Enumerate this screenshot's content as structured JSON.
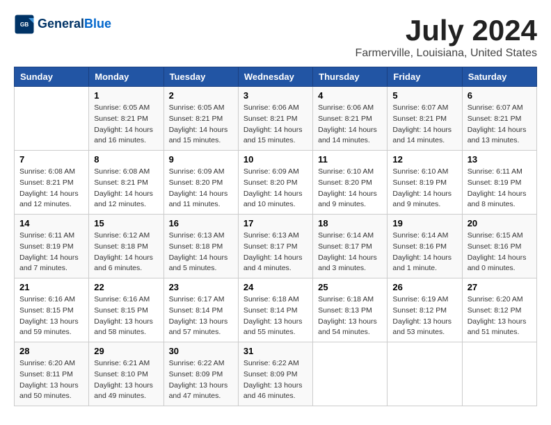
{
  "logo": {
    "line1": "General",
    "line2": "Blue"
  },
  "title": "July 2024",
  "subtitle": "Farmerville, Louisiana, United States",
  "weekdays": [
    "Sunday",
    "Monday",
    "Tuesday",
    "Wednesday",
    "Thursday",
    "Friday",
    "Saturday"
  ],
  "weeks": [
    [
      {
        "day": "",
        "info": ""
      },
      {
        "day": "1",
        "info": "Sunrise: 6:05 AM\nSunset: 8:21 PM\nDaylight: 14 hours\nand 16 minutes."
      },
      {
        "day": "2",
        "info": "Sunrise: 6:05 AM\nSunset: 8:21 PM\nDaylight: 14 hours\nand 15 minutes."
      },
      {
        "day": "3",
        "info": "Sunrise: 6:06 AM\nSunset: 8:21 PM\nDaylight: 14 hours\nand 15 minutes."
      },
      {
        "day": "4",
        "info": "Sunrise: 6:06 AM\nSunset: 8:21 PM\nDaylight: 14 hours\nand 14 minutes."
      },
      {
        "day": "5",
        "info": "Sunrise: 6:07 AM\nSunset: 8:21 PM\nDaylight: 14 hours\nand 14 minutes."
      },
      {
        "day": "6",
        "info": "Sunrise: 6:07 AM\nSunset: 8:21 PM\nDaylight: 14 hours\nand 13 minutes."
      }
    ],
    [
      {
        "day": "7",
        "info": "Sunrise: 6:08 AM\nSunset: 8:21 PM\nDaylight: 14 hours\nand 12 minutes."
      },
      {
        "day": "8",
        "info": "Sunrise: 6:08 AM\nSunset: 8:21 PM\nDaylight: 14 hours\nand 12 minutes."
      },
      {
        "day": "9",
        "info": "Sunrise: 6:09 AM\nSunset: 8:20 PM\nDaylight: 14 hours\nand 11 minutes."
      },
      {
        "day": "10",
        "info": "Sunrise: 6:09 AM\nSunset: 8:20 PM\nDaylight: 14 hours\nand 10 minutes."
      },
      {
        "day": "11",
        "info": "Sunrise: 6:10 AM\nSunset: 8:20 PM\nDaylight: 14 hours\nand 9 minutes."
      },
      {
        "day": "12",
        "info": "Sunrise: 6:10 AM\nSunset: 8:19 PM\nDaylight: 14 hours\nand 9 minutes."
      },
      {
        "day": "13",
        "info": "Sunrise: 6:11 AM\nSunset: 8:19 PM\nDaylight: 14 hours\nand 8 minutes."
      }
    ],
    [
      {
        "day": "14",
        "info": "Sunrise: 6:11 AM\nSunset: 8:19 PM\nDaylight: 14 hours\nand 7 minutes."
      },
      {
        "day": "15",
        "info": "Sunrise: 6:12 AM\nSunset: 8:18 PM\nDaylight: 14 hours\nand 6 minutes."
      },
      {
        "day": "16",
        "info": "Sunrise: 6:13 AM\nSunset: 8:18 PM\nDaylight: 14 hours\nand 5 minutes."
      },
      {
        "day": "17",
        "info": "Sunrise: 6:13 AM\nSunset: 8:17 PM\nDaylight: 14 hours\nand 4 minutes."
      },
      {
        "day": "18",
        "info": "Sunrise: 6:14 AM\nSunset: 8:17 PM\nDaylight: 14 hours\nand 3 minutes."
      },
      {
        "day": "19",
        "info": "Sunrise: 6:14 AM\nSunset: 8:16 PM\nDaylight: 14 hours\nand 1 minute."
      },
      {
        "day": "20",
        "info": "Sunrise: 6:15 AM\nSunset: 8:16 PM\nDaylight: 14 hours\nand 0 minutes."
      }
    ],
    [
      {
        "day": "21",
        "info": "Sunrise: 6:16 AM\nSunset: 8:15 PM\nDaylight: 13 hours\nand 59 minutes."
      },
      {
        "day": "22",
        "info": "Sunrise: 6:16 AM\nSunset: 8:15 PM\nDaylight: 13 hours\nand 58 minutes."
      },
      {
        "day": "23",
        "info": "Sunrise: 6:17 AM\nSunset: 8:14 PM\nDaylight: 13 hours\nand 57 minutes."
      },
      {
        "day": "24",
        "info": "Sunrise: 6:18 AM\nSunset: 8:14 PM\nDaylight: 13 hours\nand 55 minutes."
      },
      {
        "day": "25",
        "info": "Sunrise: 6:18 AM\nSunset: 8:13 PM\nDaylight: 13 hours\nand 54 minutes."
      },
      {
        "day": "26",
        "info": "Sunrise: 6:19 AM\nSunset: 8:12 PM\nDaylight: 13 hours\nand 53 minutes."
      },
      {
        "day": "27",
        "info": "Sunrise: 6:20 AM\nSunset: 8:12 PM\nDaylight: 13 hours\nand 51 minutes."
      }
    ],
    [
      {
        "day": "28",
        "info": "Sunrise: 6:20 AM\nSunset: 8:11 PM\nDaylight: 13 hours\nand 50 minutes."
      },
      {
        "day": "29",
        "info": "Sunrise: 6:21 AM\nSunset: 8:10 PM\nDaylight: 13 hours\nand 49 minutes."
      },
      {
        "day": "30",
        "info": "Sunrise: 6:22 AM\nSunset: 8:09 PM\nDaylight: 13 hours\nand 47 minutes."
      },
      {
        "day": "31",
        "info": "Sunrise: 6:22 AM\nSunset: 8:09 PM\nDaylight: 13 hours\nand 46 minutes."
      },
      {
        "day": "",
        "info": ""
      },
      {
        "day": "",
        "info": ""
      },
      {
        "day": "",
        "info": ""
      }
    ]
  ]
}
